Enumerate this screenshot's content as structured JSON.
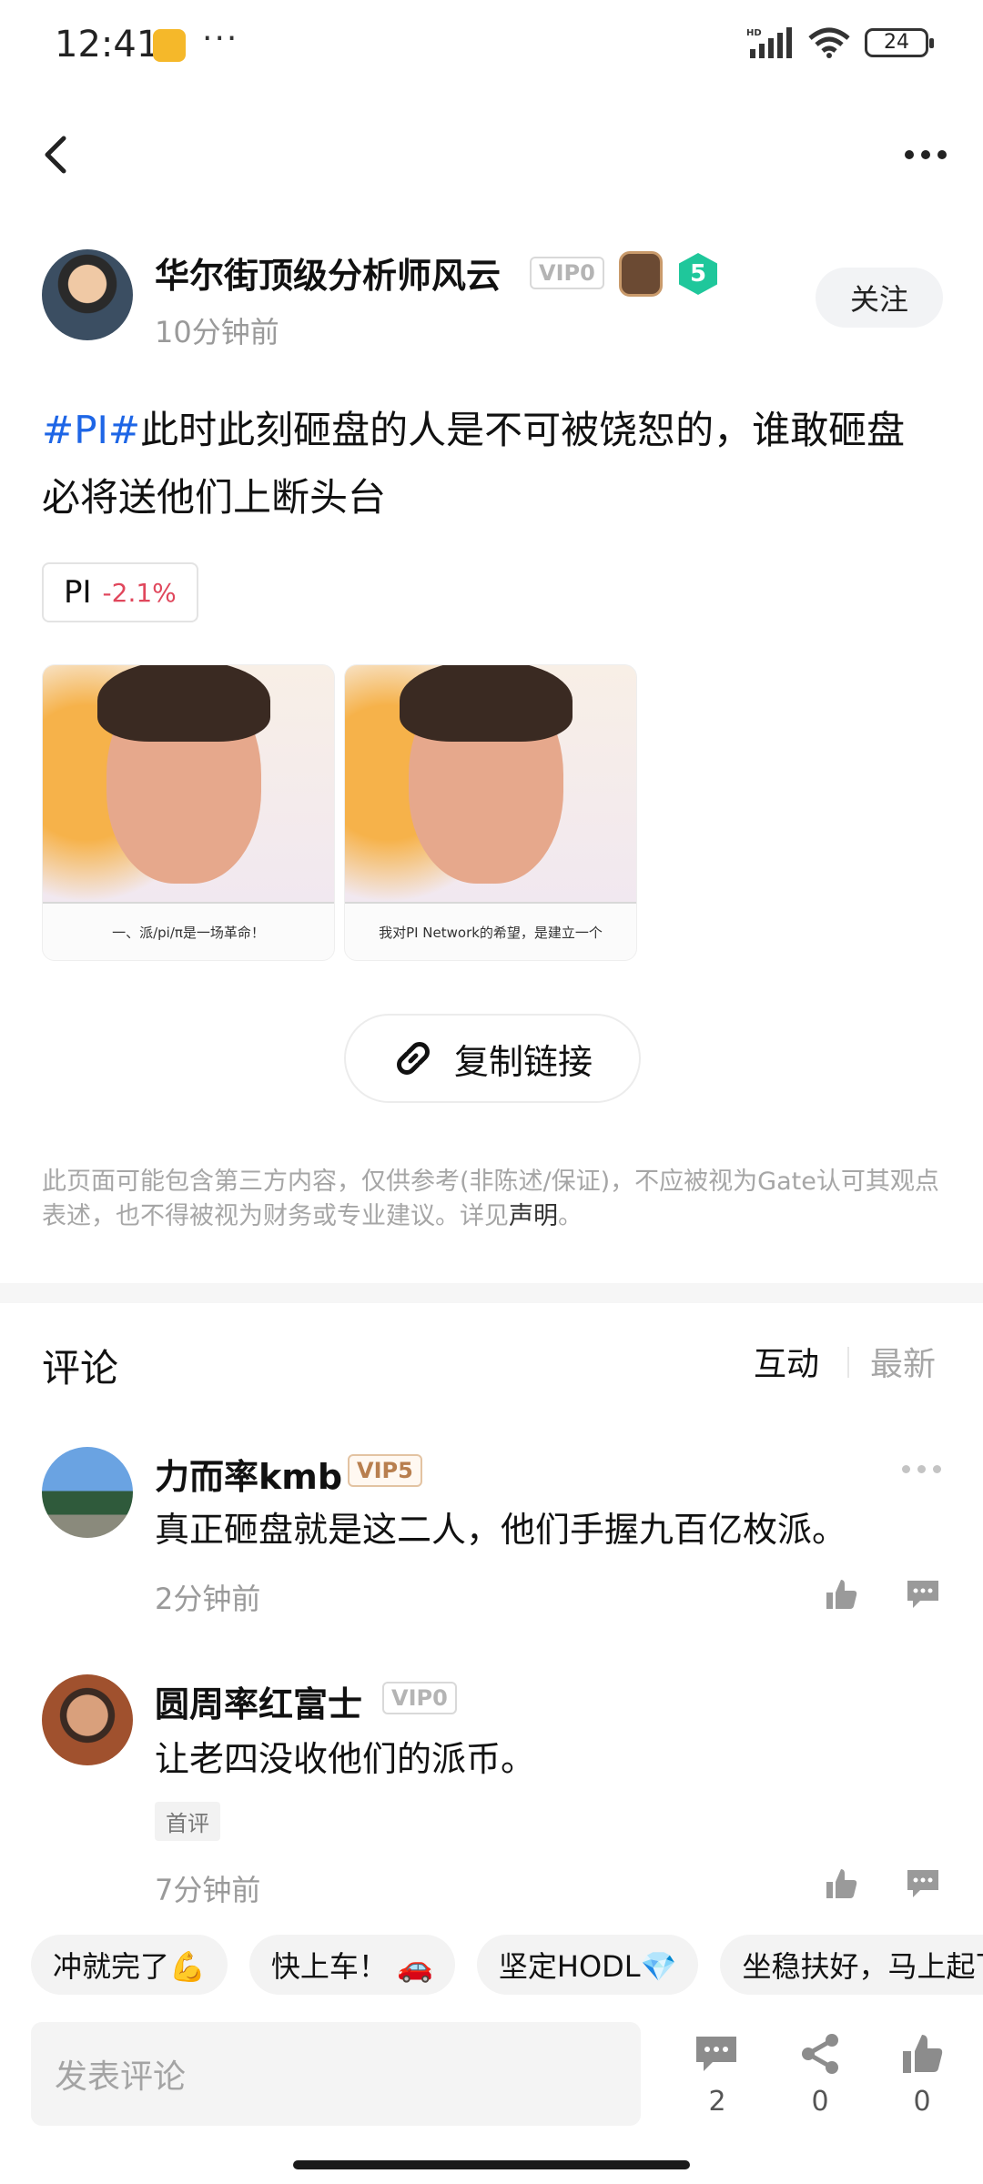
{
  "status_bar": {
    "time": "12:41",
    "dots": "···",
    "network": "HD",
    "battery": "24"
  },
  "nav": {
    "back_icon": "chevron-left-icon",
    "more_icon": "more-horizontal-icon"
  },
  "author": {
    "name": "华尔街顶级分析师风云",
    "vip": "VIP0",
    "level": "5",
    "time": "10分钟前",
    "follow_label": "关注"
  },
  "post": {
    "hashtag": "#PI#",
    "text": "此时此刻砸盘的人是不可被饶恕的，谁敢砸盘必将送他们上断头台",
    "token": {
      "name": "PI",
      "change": "-2.1%",
      "change_color": "#e0475c"
    },
    "images": [
      {
        "caption": "一、派/pi/π是一场革命！"
      },
      {
        "caption": "我对PI Network的希望，是建立一个"
      }
    ],
    "copy_link_label": "复制链接"
  },
  "disclaimer": {
    "text": "此页面可能包含第三方内容，仅供参考(非陈述/保证)，不应被视为Gate认可其观点表述，也不得被视为财务或专业建议。详见",
    "link": "声明",
    "end": "。"
  },
  "comments_section": {
    "title": "评论",
    "sort_options": [
      "互动",
      "最新"
    ],
    "active_sort": "互动",
    "comments": [
      {
        "name": "力而率kmb",
        "vip": "VIP5",
        "text": "真正砸盘就是这二人，他们手握九百亿枚派。",
        "time": "2分钟前"
      },
      {
        "name": "圆周率红富士",
        "vip": "VIP0",
        "text": "让老四没收他们的派币。",
        "tag": "首评",
        "time": "7分钟前"
      }
    ]
  },
  "quick_replies": [
    "冲就完了💪",
    "快上车！ 🚗",
    "坚定HODL💎",
    "坐稳扶好，马上起飞"
  ],
  "bottom_bar": {
    "input_placeholder": "发表评论",
    "comment_count": "2",
    "share_count": "0",
    "like_count": "0"
  },
  "colors": {
    "accent_blue": "#1e66e6",
    "negative_red": "#e0475c",
    "level_badge": "#1fc79b"
  }
}
